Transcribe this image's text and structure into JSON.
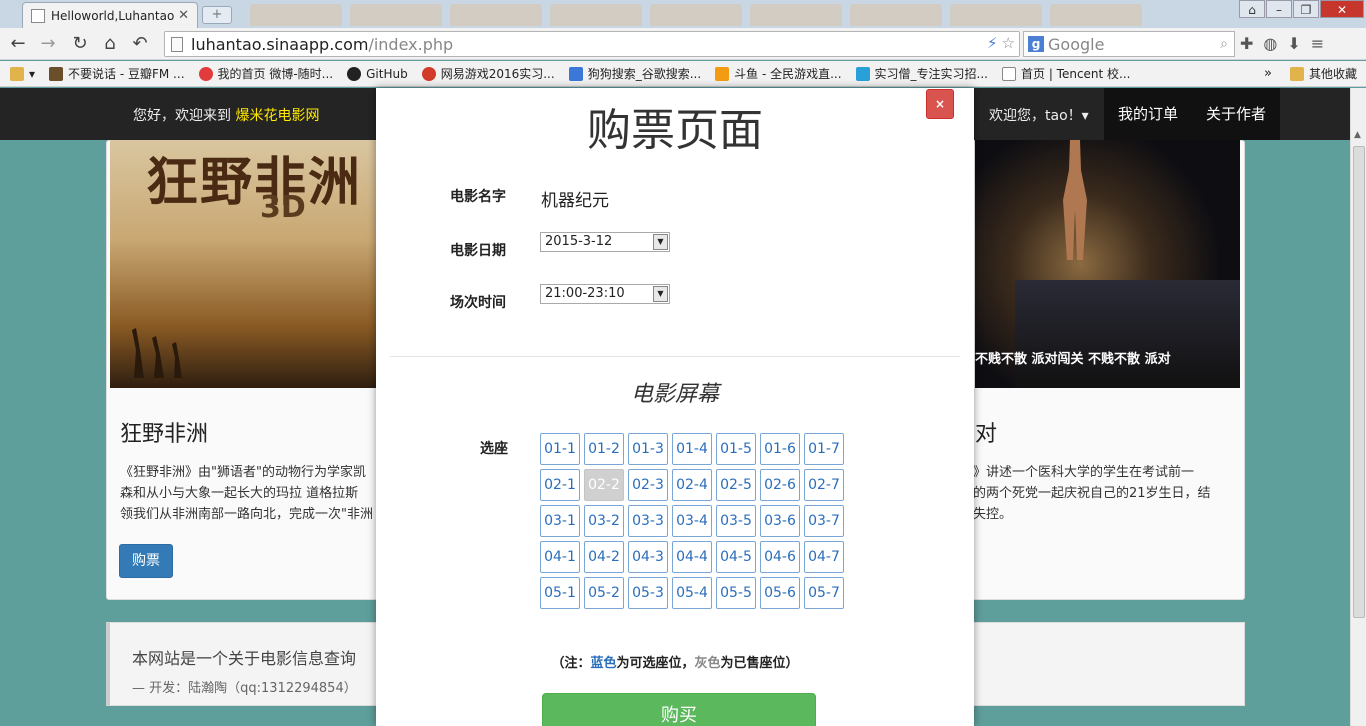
{
  "browser": {
    "active_tab_title": "Helloworld,Luhantao",
    "url_host": "luhantao.sinaapp.com",
    "url_path": "/index.php",
    "search_placeholder": "Google",
    "bookmarks": [
      "不要说话 - 豆瓣FM ...",
      "我的首页 微博-随时...",
      "GitHub",
      "网易游戏2016实习...",
      "狗狗搜索_谷歌搜索...",
      "斗鱼 - 全民游戏直...",
      "实习僧_专注实习招...",
      "首页 | Tencent 校..."
    ],
    "bookmarks_more": "»",
    "other_bookmarks": "其他收藏"
  },
  "nav": {
    "welcome_prefix": "您好，欢迎来到",
    "brand": "爆米花电影网",
    "user_greeting": "欢迎您，tao！▾",
    "my_orders": "我的订单",
    "about_author": "关于作者"
  },
  "movies": [
    {
      "title": "狂野非洲",
      "poster_text": "狂野非洲",
      "poster_sub": "3D",
      "description": "《狂野非洲》由\"狮语者\"的动物行为学家凯\n森和从小与大象一起长大的玛拉 道格拉斯\n领我们从非洲南部一路向北，完成一次\"非洲",
      "buy_label": "购票"
    },
    {
      "title": "对",
      "poster_tagline": "不贱不散  派对闯关  不贱不散  派对",
      "description": "》讲述一个医科大学的学生在考试前一\n的两个死党一起庆祝自己的21岁生日，结\n失控。"
    }
  ],
  "footer": {
    "text": "本网站是一个关于电影信息查询",
    "credit": "— 开发：陆瀚陶（qq:1312294854）"
  },
  "modal": {
    "title": "购票页面",
    "close_label": "×",
    "movie_name_label": "电影名字",
    "movie_name": "机器纪元",
    "date_label": "电影日期",
    "date_value": "2015-3-12",
    "time_label": "场次时间",
    "time_value": "21:00-23:10",
    "screen_title": "电影屏幕",
    "seat_label": "选座",
    "seats": [
      [
        "01-1",
        "01-2",
        "01-3",
        "01-4",
        "01-5",
        "01-6",
        "01-7"
      ],
      [
        "02-1",
        "02-2",
        "02-3",
        "02-4",
        "02-5",
        "02-6",
        "02-7"
      ],
      [
        "03-1",
        "03-2",
        "03-3",
        "03-4",
        "03-5",
        "03-6",
        "03-7"
      ],
      [
        "04-1",
        "04-2",
        "04-3",
        "04-4",
        "04-5",
        "04-6",
        "04-7"
      ],
      [
        "05-1",
        "05-2",
        "05-3",
        "05-4",
        "05-5",
        "05-6",
        "05-7"
      ]
    ],
    "sold_seats": [
      "02-2"
    ],
    "note_prefix": "（注：",
    "note_blue": "蓝色",
    "note_mid": "为可选座位，",
    "note_grey": "灰色",
    "note_suffix": "为已售座位）",
    "buy_label": "购买"
  },
  "colors": {
    "seat_available": "#2a6ebb",
    "seat_sold": "#d0d0d0",
    "buy_button": "#5cb85c",
    "close_button": "#d9534f",
    "brand_text": "#ffea00"
  }
}
